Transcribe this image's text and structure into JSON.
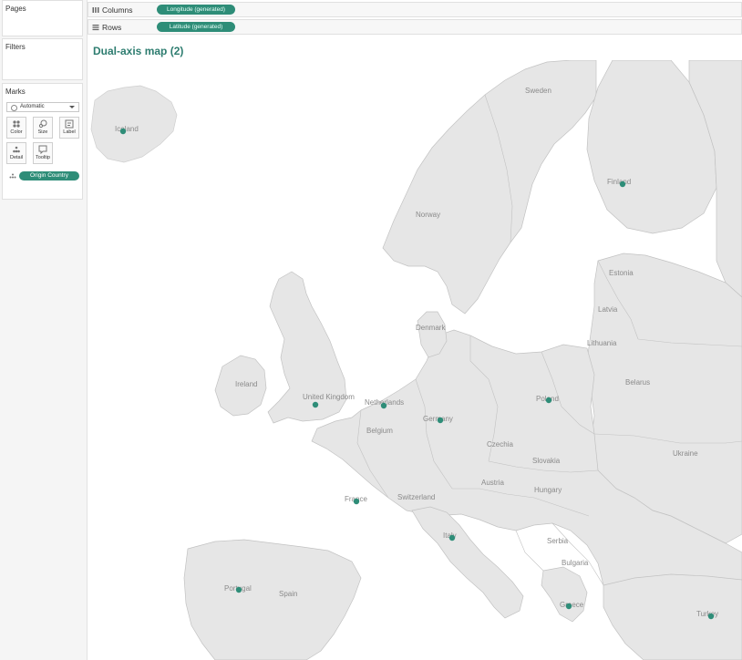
{
  "sidebar": {
    "pages_label": "Pages",
    "filters_label": "Filters",
    "marks_label": "Marks",
    "mark_type": "Automatic",
    "mark_buttons": [
      {
        "label": "Color",
        "icon": "color-icon"
      },
      {
        "label": "Size",
        "icon": "size-icon"
      },
      {
        "label": "Label",
        "icon": "label-icon"
      },
      {
        "label": "Detail",
        "icon": "detail-icon"
      },
      {
        "label": "Tooltip",
        "icon": "tooltip-icon"
      }
    ],
    "detail_field": "Origin Country"
  },
  "shelves": {
    "columns_label": "Columns",
    "columns_pill": "Longitude (generated)",
    "rows_label": "Rows",
    "rows_pill": "Latitude (generated)"
  },
  "view": {
    "title": "Dual-axis map (2)"
  },
  "map": {
    "colors": {
      "land": "#e6e6e6",
      "border": "#c2c2c2",
      "water": "#ffffff",
      "label": "#8a8a8a",
      "point": "#2e8d78"
    },
    "country_labels": [
      {
        "name": "Iceland"
      },
      {
        "name": "Sweden"
      },
      {
        "name": "Finland"
      },
      {
        "name": "Norway"
      },
      {
        "name": "Estonia"
      },
      {
        "name": "Latvia"
      },
      {
        "name": "Denmark"
      },
      {
        "name": "Lithuania"
      },
      {
        "name": "Ireland"
      },
      {
        "name": "United Kingdom"
      },
      {
        "name": "Netherlands"
      },
      {
        "name": "Belgium"
      },
      {
        "name": "Germany"
      },
      {
        "name": "Poland"
      },
      {
        "name": "Belarus"
      },
      {
        "name": "Czechia"
      },
      {
        "name": "Slovakia"
      },
      {
        "name": "Ukraine"
      },
      {
        "name": "Austria"
      },
      {
        "name": "Switzerland"
      },
      {
        "name": "France"
      },
      {
        "name": "Hungary"
      },
      {
        "name": "Italy"
      },
      {
        "name": "Serbia"
      },
      {
        "name": "Bulgaria"
      },
      {
        "name": "Portugal"
      },
      {
        "name": "Spain"
      },
      {
        "name": "Greece"
      },
      {
        "name": "Turkey"
      }
    ],
    "points": [
      "Iceland",
      "Finland",
      "United Kingdom",
      "Netherlands",
      "Germany",
      "Poland",
      "France",
      "Italy",
      "Portugal",
      "Greece",
      "Turkey"
    ]
  }
}
